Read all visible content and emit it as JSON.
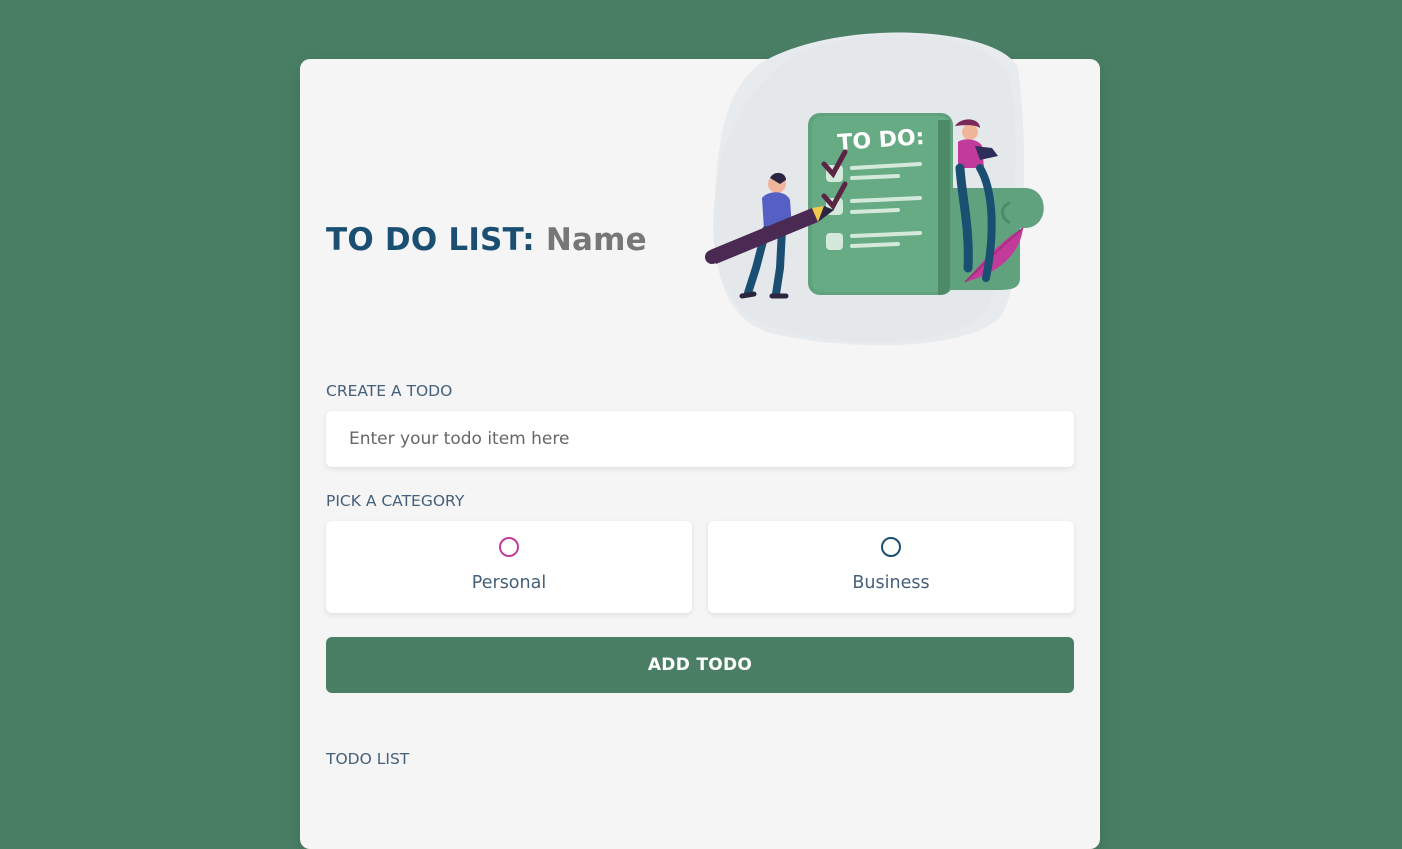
{
  "header": {
    "title_prefix": "TO DO LIST:",
    "name": "Name"
  },
  "illustration": {
    "text": "TO DO:"
  },
  "create": {
    "label": "CREATE A TODO",
    "input_value": "",
    "placeholder": "Enter your todo item here"
  },
  "category": {
    "label": "PICK A CATEGORY",
    "options": [
      {
        "label": "Personal",
        "color": "#c23b9b"
      },
      {
        "label": "Business",
        "color": "#1b4f72"
      }
    ]
  },
  "actions": {
    "add_label": "ADD TODO"
  },
  "list": {
    "label": "TODO LIST"
  },
  "colors": {
    "background": "#4a7f65",
    "card": "#f5f5f5",
    "title": "#1b4f72",
    "name": "#777777",
    "label": "#44607a",
    "button": "#4a7f65"
  }
}
